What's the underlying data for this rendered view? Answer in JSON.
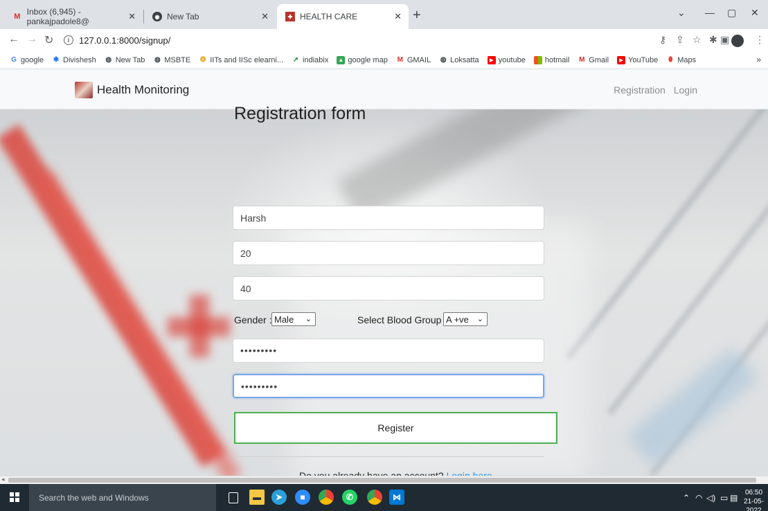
{
  "browser": {
    "tabs": [
      {
        "title": "Inbox (6,945) - pankajpadole8@",
        "close": "✕"
      },
      {
        "title": "New Tab",
        "close": "✕"
      },
      {
        "title": "HEALTH CARE",
        "close": "✕"
      }
    ],
    "new_tab": "+",
    "window_controls": {
      "minimize": "—",
      "maximize": "▢",
      "close": "✕",
      "menu": "⌄"
    },
    "url": "127.0.0.1:8000/signup/",
    "bookmarks": [
      "google",
      "Divishesh",
      "New Tab",
      "MSBTE",
      "IITs and IISc elearni...",
      "indiabix",
      "google map",
      "GMAIL",
      "Loksatta",
      "youtube",
      "hotmail",
      "Gmail",
      "YouTube",
      "Maps"
    ],
    "bookmarks_more": "»"
  },
  "site": {
    "brand": "Health Monitoring",
    "nav": {
      "registration": "Registration",
      "login": "Login"
    }
  },
  "form": {
    "title": "Registration form",
    "name_value": "Harsh",
    "age_value": "20",
    "weight_value": "40",
    "gender_label": "Gender :",
    "gender_value": "Male",
    "blood_label": "Select Blood Group :",
    "blood_value": "A +ve",
    "password_mask": "•••••••••",
    "confirm_mask": "•••••••••",
    "register_label": "Register",
    "already_text": "Do you already have an account?",
    "login_link": "Login here"
  },
  "taskbar": {
    "search_placeholder": "Search the web and Windows",
    "time": "06:50",
    "date": "21-05-2022"
  },
  "colors": {
    "register_border": "#4caf50",
    "link": "#2196f3",
    "taskbar": "#1f2a33"
  }
}
